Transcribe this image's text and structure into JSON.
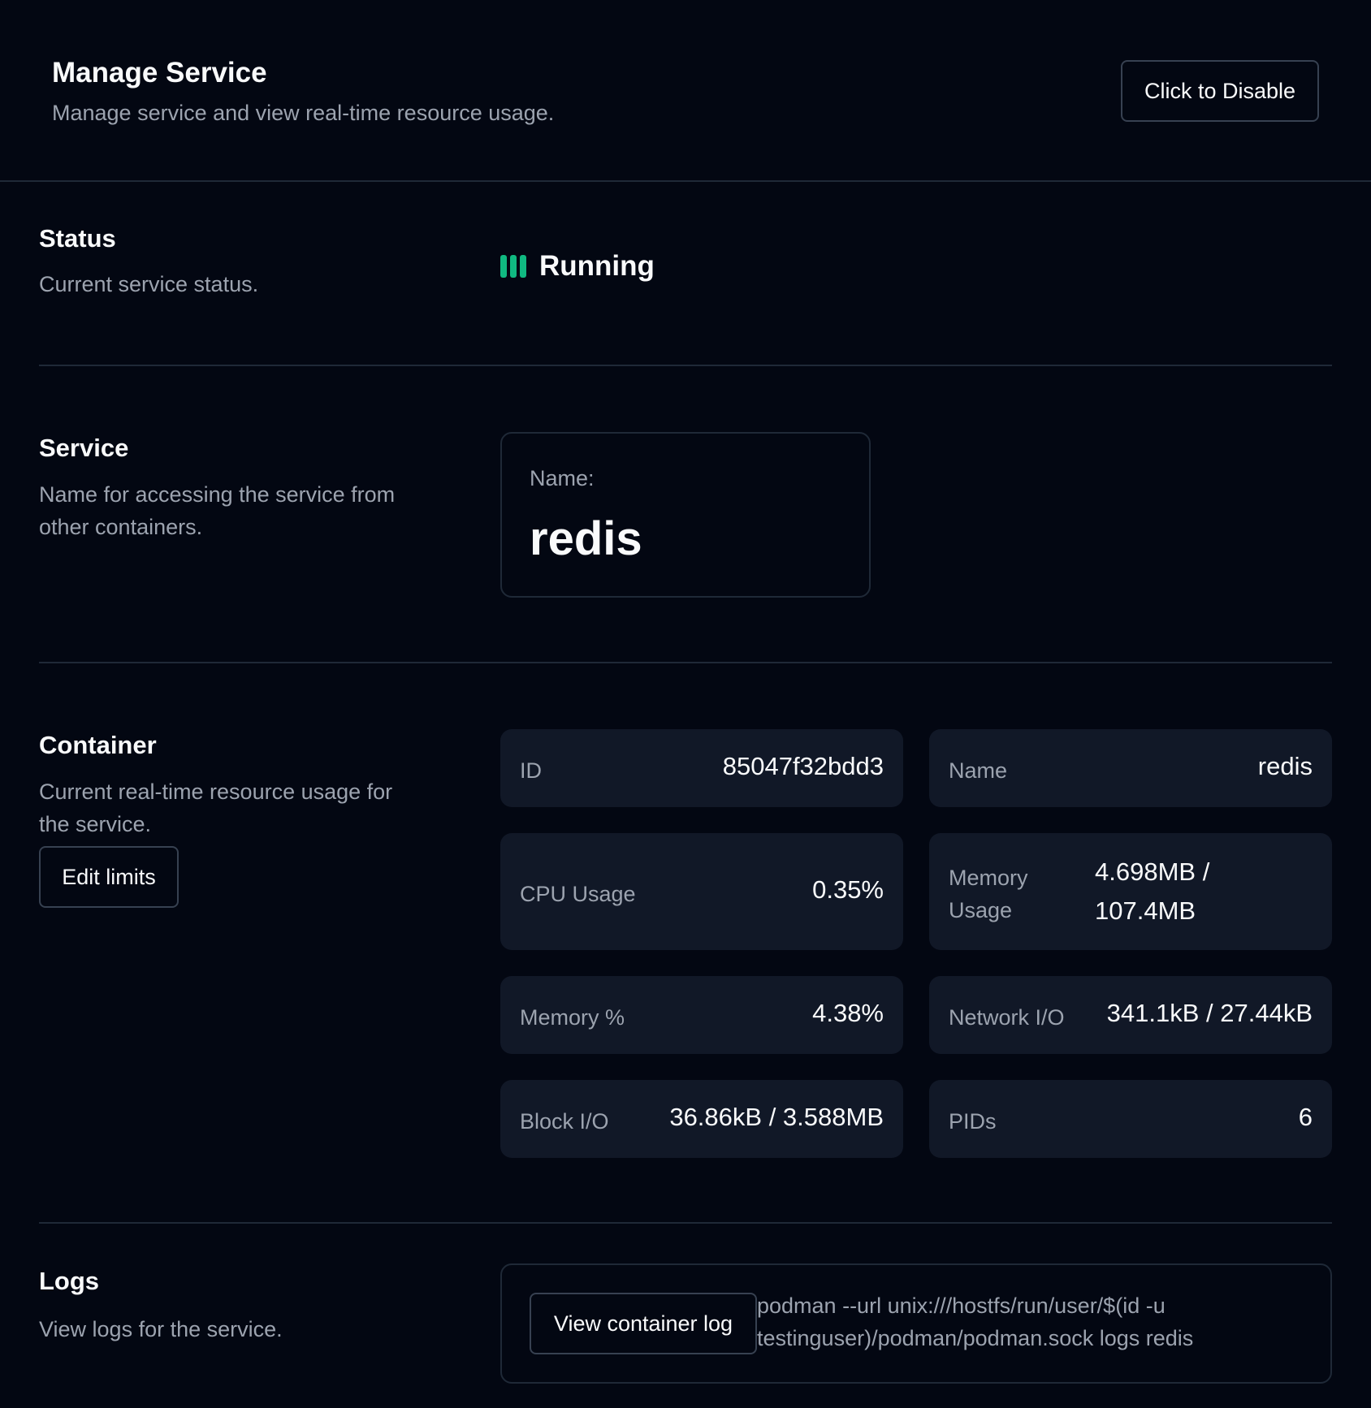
{
  "header": {
    "title": "Manage Service",
    "subtitle": "Manage service and view real-time resource usage.",
    "disable_label": "Click to Disable"
  },
  "status_section": {
    "title": "Status",
    "description": "Current service status.",
    "value": "Running",
    "color": "#10b981",
    "icon": "running-bars-icon"
  },
  "service_section": {
    "title": "Service",
    "description": "Name for accessing the service from other containers.",
    "name_label": "Name:",
    "name_value": "redis"
  },
  "container_section": {
    "title": "Container",
    "description": "Current real-time resource usage for the service.",
    "edit_label": "Edit limits",
    "stats": {
      "id": {
        "label": "ID",
        "value": "85047f32bdd3"
      },
      "name": {
        "label": "Name",
        "value": "redis"
      },
      "cpu": {
        "label": "CPU Usage",
        "value": "0.35%"
      },
      "memory_usage": {
        "label": "Memory Usage",
        "value": "4.698MB / 107.4MB"
      },
      "memory_pct": {
        "label": "Memory %",
        "value": "4.38%"
      },
      "network_io": {
        "label": "Network I/O",
        "value": "341.1kB / 27.44kB"
      },
      "block_io": {
        "label": "Block I/O",
        "value": "36.86kB / 3.588MB"
      },
      "pids": {
        "label": "PIDs",
        "value": "6"
      }
    }
  },
  "logs_section": {
    "title": "Logs",
    "description": "View logs for the service.",
    "button_label": "View container log",
    "command": "podman --url unix:///hostfs/run/user/$(id -u testinguser)/podman/podman.sock logs redis"
  }
}
